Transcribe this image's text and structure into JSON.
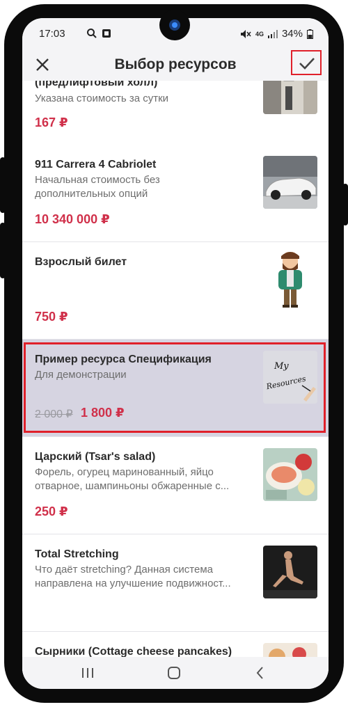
{
  "status_bar": {
    "time": "17:03",
    "battery": "34%",
    "network": "4G"
  },
  "app_bar": {
    "title": "Выбор ресурсов",
    "close_icon": "close-icon",
    "confirm_icon": "checkmark-icon"
  },
  "items": [
    {
      "name": "(предлифтовый холл)",
      "description": "Указана стоимость за сутки",
      "price": "167 ₽"
    },
    {
      "name": "911 Carrera 4 Cabriolet",
      "description": "Начальная стоимость без дополнительных опций",
      "price": "10 340 000 ₽"
    },
    {
      "name": "Взрослый билет",
      "description": "",
      "price": "750 ₽"
    },
    {
      "name": "Пример ресурса Спецификация",
      "description": "Для демонстрации",
      "old_price": "2 000 ₽",
      "price": "1 800 ₽",
      "thumb_text": "My Resources"
    },
    {
      "name": "Царский (Tsar's salad)",
      "description": "Форель, огурец маринованный, яйцо отварное, шампиньоны обжаренные с...",
      "price": "250 ₽"
    },
    {
      "name": "Total Stretching",
      "description": "Что даёт stretching? Данная система направлена на улучшение подвижност...",
      "price": ""
    },
    {
      "name": "Сырники (Cottage cheese pancakes)",
      "description": "",
      "price": ""
    }
  ],
  "colors": {
    "price": "#d0304a",
    "selected_bg": "#d6d4e1",
    "highlight": "#e0202a"
  },
  "nav": {
    "recent_icon": "recent-apps-icon",
    "home_icon": "home-icon",
    "back_icon": "back-icon"
  }
}
